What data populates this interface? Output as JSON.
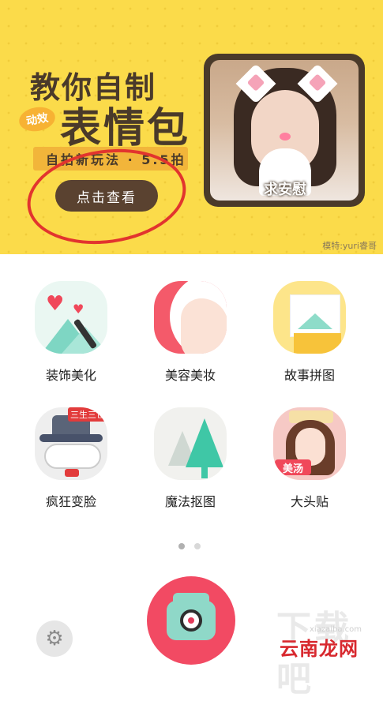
{
  "banner": {
    "title_line1": "教你自制",
    "badge": "动效",
    "title_line2": "表情包",
    "subtitle": "自拍新玩法 · 5.5拍",
    "button_label": "点击查看",
    "photo_caption": "求安慰",
    "model_credit": "模特:yuri睿哥",
    "colors": {
      "background": "#fbdb4a",
      "button": "#5a4230",
      "annotation_circle": "#e2342e"
    }
  },
  "features": [
    {
      "label": "装饰美化",
      "icon": "decorate-icon"
    },
    {
      "label": "美容美妆",
      "icon": "beauty-icon"
    },
    {
      "label": "故事拼图",
      "icon": "story-collage-icon"
    },
    {
      "label": "疯狂变脸",
      "icon": "crazy-face-icon",
      "tag": "三生三世"
    },
    {
      "label": "魔法抠图",
      "icon": "magic-cutout-icon"
    },
    {
      "label": "大头贴",
      "icon": "big-head-sticker-icon",
      "sticker": "美汤"
    }
  ],
  "pager": {
    "pages": 2,
    "active": 0
  },
  "bottom": {
    "settings_icon": "gear-icon",
    "camera_icon": "camera-icon",
    "camera_color": "#f24a63"
  },
  "watermark": {
    "text": "云南龙网",
    "bg_text": "下载吧",
    "url": "xiazaiba.com"
  }
}
